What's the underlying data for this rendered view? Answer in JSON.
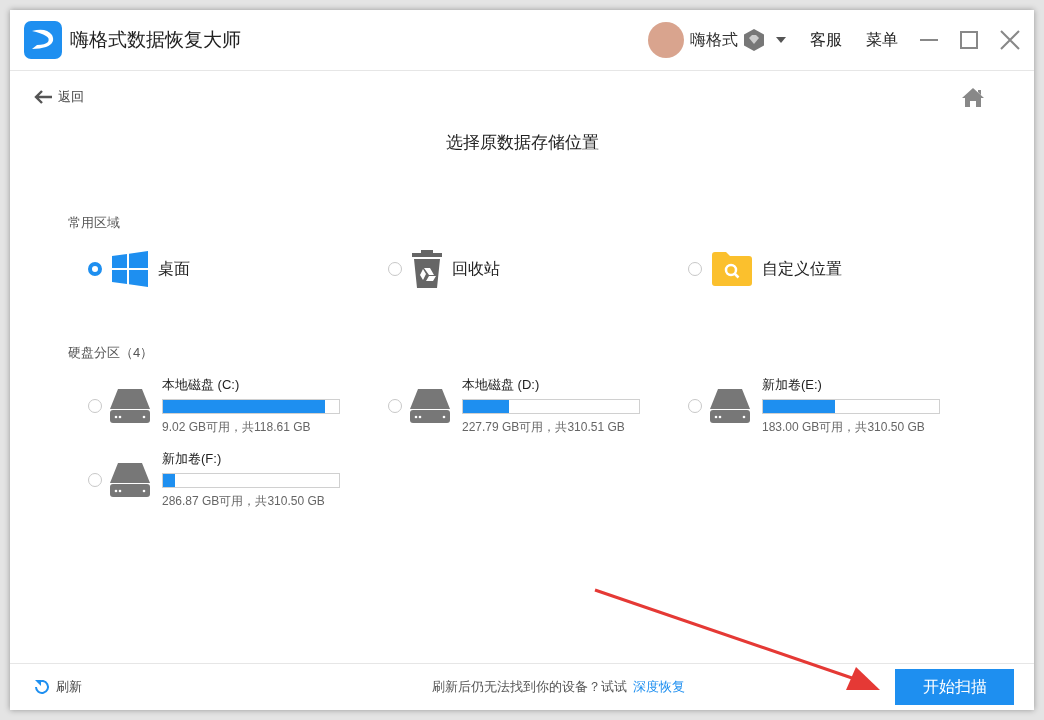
{
  "window": {
    "title": "嗨格式数据恢复大师"
  },
  "user": {
    "name": "嗨格式"
  },
  "header_links": [
    "客服",
    "菜单"
  ],
  "back": "返回",
  "heading": "选择原数据存储位置",
  "common": {
    "label": "常用区域",
    "items": [
      {
        "kind": "desktop",
        "label": "桌面",
        "selected": true
      },
      {
        "kind": "recycle",
        "label": "回收站",
        "selected": false
      },
      {
        "kind": "custom",
        "label": "自定义位置",
        "selected": false
      }
    ]
  },
  "disks": {
    "label": "硬盘分区（4）",
    "items": [
      {
        "name": "本地磁盘 (C:)",
        "level": 0.92,
        "info": "9.02 GB可用，共118.61 GB",
        "selected": false
      },
      {
        "name": "本地磁盘 (D:)",
        "level": 0.26,
        "info": "227.79 GB可用，共310.51 GB",
        "selected": false
      },
      {
        "name": "新加卷(E:)",
        "level": 0.41,
        "info": "183.00 GB可用，共310.50 GB",
        "selected": false
      },
      {
        "name": "新加卷(F:)",
        "level": 0.07,
        "info": "286.87 GB可用，共310.50 GB",
        "selected": false
      }
    ]
  },
  "footer": {
    "refresh": "刷新",
    "hint": "刷新后仍无法找到你的设备？试试",
    "link": "深度恢复",
    "button": "开始扫描"
  }
}
